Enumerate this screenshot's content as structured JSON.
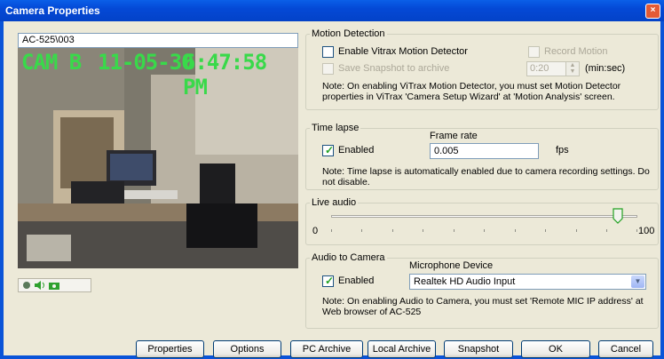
{
  "window": {
    "title": "Camera Properties",
    "close_glyph": "×"
  },
  "camera": {
    "name": "AC-525\\003",
    "osd_cam": "CAM B",
    "osd_date": "11-05-30",
    "osd_time": "6:47:58 PM"
  },
  "motion_detection": {
    "legend": "Motion Detection",
    "enable_label": "Enable Vitrax Motion Detector",
    "enable_checked": false,
    "record_label": "Record Motion",
    "save_snapshot_label": "Save Snapshot to archive",
    "interval_value": "0:20",
    "interval_unit": "(min:sec)",
    "note": "Note: On enabling ViTrax Motion Detector, you must set Motion Detector properties in ViTrax 'Camera Setup Wizard' at 'Motion Analysis' screen."
  },
  "time_lapse": {
    "legend": "Time lapse",
    "enabled_label": "Enabled",
    "enabled_checked": true,
    "frame_rate_label": "Frame rate",
    "frame_rate_value": "0.005",
    "unit": "fps",
    "note": "Note: Time lapse is automatically enabled due to camera recording settings. Do not disable."
  },
  "live_audio": {
    "legend": "Live audio",
    "min": "0",
    "max": "100",
    "level": 100
  },
  "audio_to_camera": {
    "legend": "Audio to Camera",
    "enabled_label": "Enabled",
    "enabled_checked": true,
    "device_label": "Microphone Device",
    "device_value": "Realtek HD Audio Input",
    "note": "Note: On enabling Audio to Camera, you must set 'Remote MIC IP address' at Web browser of AC-525"
  },
  "buttons": {
    "properties": "Properties",
    "options": "Options",
    "pc_archive": "PC Archive",
    "local_archive": "Local Archive",
    "snapshot": "Snapshot",
    "ok": "OK",
    "cancel": "Cancel"
  },
  "colors": {
    "titlebar": "#0449d6",
    "dialog_bg": "#ece9d8",
    "osd_text": "#39d94a",
    "checkbox_tick": "#21a121"
  }
}
